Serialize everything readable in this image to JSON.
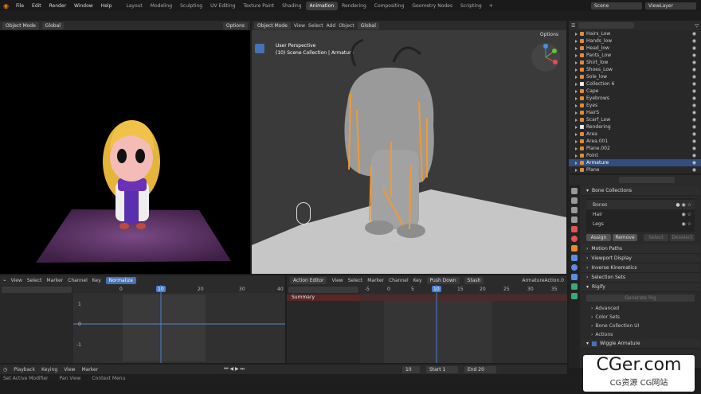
{
  "menu": [
    "File",
    "Edit",
    "Render",
    "Window",
    "Help"
  ],
  "workspaces": [
    "Layout",
    "Modeling",
    "Sculpting",
    "UV Editing",
    "Texture Paint",
    "Shading",
    "Animation",
    "Rendering",
    "Compositing",
    "Geometry Nodes",
    "Scripting"
  ],
  "active_workspace": "Animation",
  "scene": "Scene",
  "view_layer": "ViewLayer",
  "left_viewport": {
    "mode": "Object Mode",
    "orient": "Global",
    "options": "Options"
  },
  "main_viewport": {
    "mode": "Object Mode",
    "menu": [
      "View",
      "Select",
      "Add",
      "Object"
    ],
    "orient": "Global",
    "options": "Options",
    "info1": "User Perspective",
    "info2": "(10) Scene Collection | Armature"
  },
  "outliner": {
    "search": "",
    "rows": [
      {
        "label": "Hairs_Low",
        "kind": "obj",
        "sel": false
      },
      {
        "label": "Hands_low",
        "kind": "obj",
        "sel": false
      },
      {
        "label": "Head_low",
        "kind": "obj",
        "sel": false
      },
      {
        "label": "Pants_Low",
        "kind": "obj",
        "sel": false
      },
      {
        "label": "Shirt_low",
        "kind": "obj",
        "sel": false
      },
      {
        "label": "Shoes_Low",
        "kind": "obj",
        "sel": false
      },
      {
        "label": "Sole_low",
        "kind": "obj",
        "sel": false
      },
      {
        "label": "Collection 6",
        "kind": "col",
        "sel": false
      },
      {
        "label": "Cape",
        "kind": "obj",
        "sel": false
      },
      {
        "label": "Eyebrows",
        "kind": "obj",
        "sel": false
      },
      {
        "label": "Eyes",
        "kind": "obj",
        "sel": false
      },
      {
        "label": "HairS",
        "kind": "obj",
        "sel": false
      },
      {
        "label": "Scarf_Low",
        "kind": "obj",
        "sel": false
      },
      {
        "label": "Rendering",
        "kind": "col",
        "sel": false
      },
      {
        "label": "Area",
        "kind": "obj",
        "sel": false
      },
      {
        "label": "Area.001",
        "kind": "obj",
        "sel": false
      },
      {
        "label": "Plane.002",
        "kind": "obj",
        "sel": false
      },
      {
        "label": "Point",
        "kind": "obj",
        "sel": false
      },
      {
        "label": "Armature",
        "kind": "obj",
        "sel": true
      },
      {
        "label": "Plane",
        "kind": "obj",
        "sel": false
      }
    ]
  },
  "props": {
    "bone_collections": "Bone Collections",
    "bones": [
      "Bones",
      "Hair",
      "Legs"
    ],
    "assign": "Assign",
    "remove": "Remove",
    "select": "Select",
    "deselect": "Deselect",
    "sections": [
      "Motion Paths",
      "Viewport Display",
      "Inverse Kinematics",
      "Selection Sets"
    ],
    "rigify": "Rigify",
    "generate": "Generate Rig",
    "sub": [
      "Advanced",
      "Color Sets",
      "Bone Collection UI",
      "Actions"
    ],
    "wiggle": "Wiggle Armature"
  },
  "graph": {
    "menu": [
      "View",
      "Select",
      "Marker",
      "Channel",
      "Key"
    ],
    "normalize": "Normalize",
    "ticks": [
      "0",
      "10",
      "20",
      "30",
      "40"
    ],
    "y": [
      "1",
      "0",
      "-1"
    ],
    "frame": "10"
  },
  "action": {
    "menu": [
      "View",
      "Select",
      "Marker",
      "Channel",
      "Key"
    ],
    "mode": "Action Editor",
    "push": "Push Down",
    "stash": "Stash",
    "action_name": "ArmatureAction.0",
    "summary": "Summary",
    "ticks": [
      "-5",
      "0",
      "5",
      "10",
      "15",
      "20",
      "25",
      "30",
      "35"
    ],
    "frame": "10"
  },
  "timeline": {
    "menu": [
      "Playback",
      "Keying",
      "View",
      "Marker"
    ],
    "current": "10",
    "start_label": "Start",
    "start": "1",
    "end_label": "End",
    "end": "20"
  },
  "status": [
    "Set Active Modifier",
    "Pan View",
    "Context Menu"
  ],
  "watermark": {
    "big": "CGer.com",
    "small": "CG资源  CG网站"
  }
}
